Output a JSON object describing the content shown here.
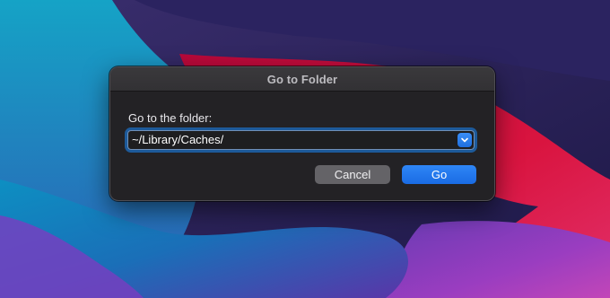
{
  "dialog": {
    "title": "Go to Folder",
    "prompt": "Go to the folder:",
    "path_value": "~/Library/Caches/",
    "dropdown_icon": "chevron-down-icon",
    "cancel_label": "Cancel",
    "go_label": "Go"
  },
  "colors": {
    "dialog_background": "#232225",
    "field_focus_ring": "#1d5a9a",
    "accent_blue": "#1a6be4",
    "cancel_button": "#646367"
  }
}
